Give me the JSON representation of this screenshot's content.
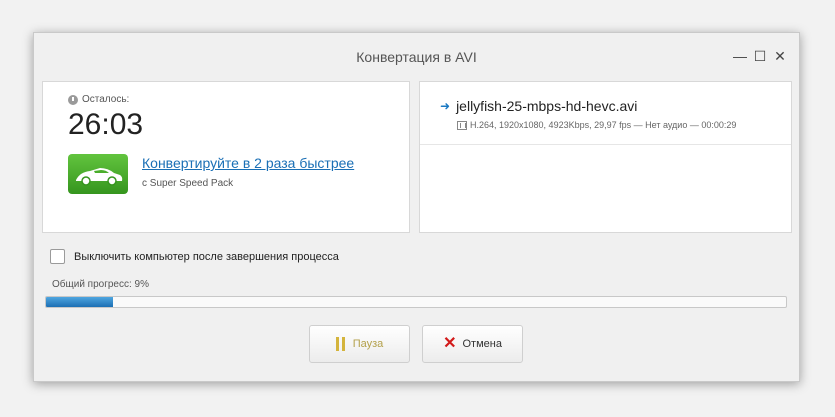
{
  "window": {
    "title": "Конвертация в AVI",
    "controls": {
      "minimize": "—",
      "maximize": "☐",
      "close": "✕"
    }
  },
  "left_panel": {
    "remaining_label": "Осталось:",
    "remaining_time": "26:03",
    "promo_link": "Конвертируйте в 2 раза быстрее",
    "promo_sub": "с Super Speed Pack"
  },
  "right_panel": {
    "filename": "jellyfish-25-mbps-hd-hevc.avi",
    "meta": "H.264, 1920x1080, 4923Kbps, 29,97 fps — Нет аудио — 00:00:29"
  },
  "shutdown_label": "Выключить компьютер после завершения процесса",
  "shutdown_checked": false,
  "progress": {
    "label": "Общий прогресс: 9%",
    "fraction": 0.09
  },
  "buttons": {
    "pause": "Пауза",
    "cancel": "Отмена"
  },
  "colors": {
    "accent": "#1a6fb5",
    "progress": "#1c6fb4",
    "cancel_icon": "#d21a1a",
    "pause_icon": "#d4b43c"
  }
}
